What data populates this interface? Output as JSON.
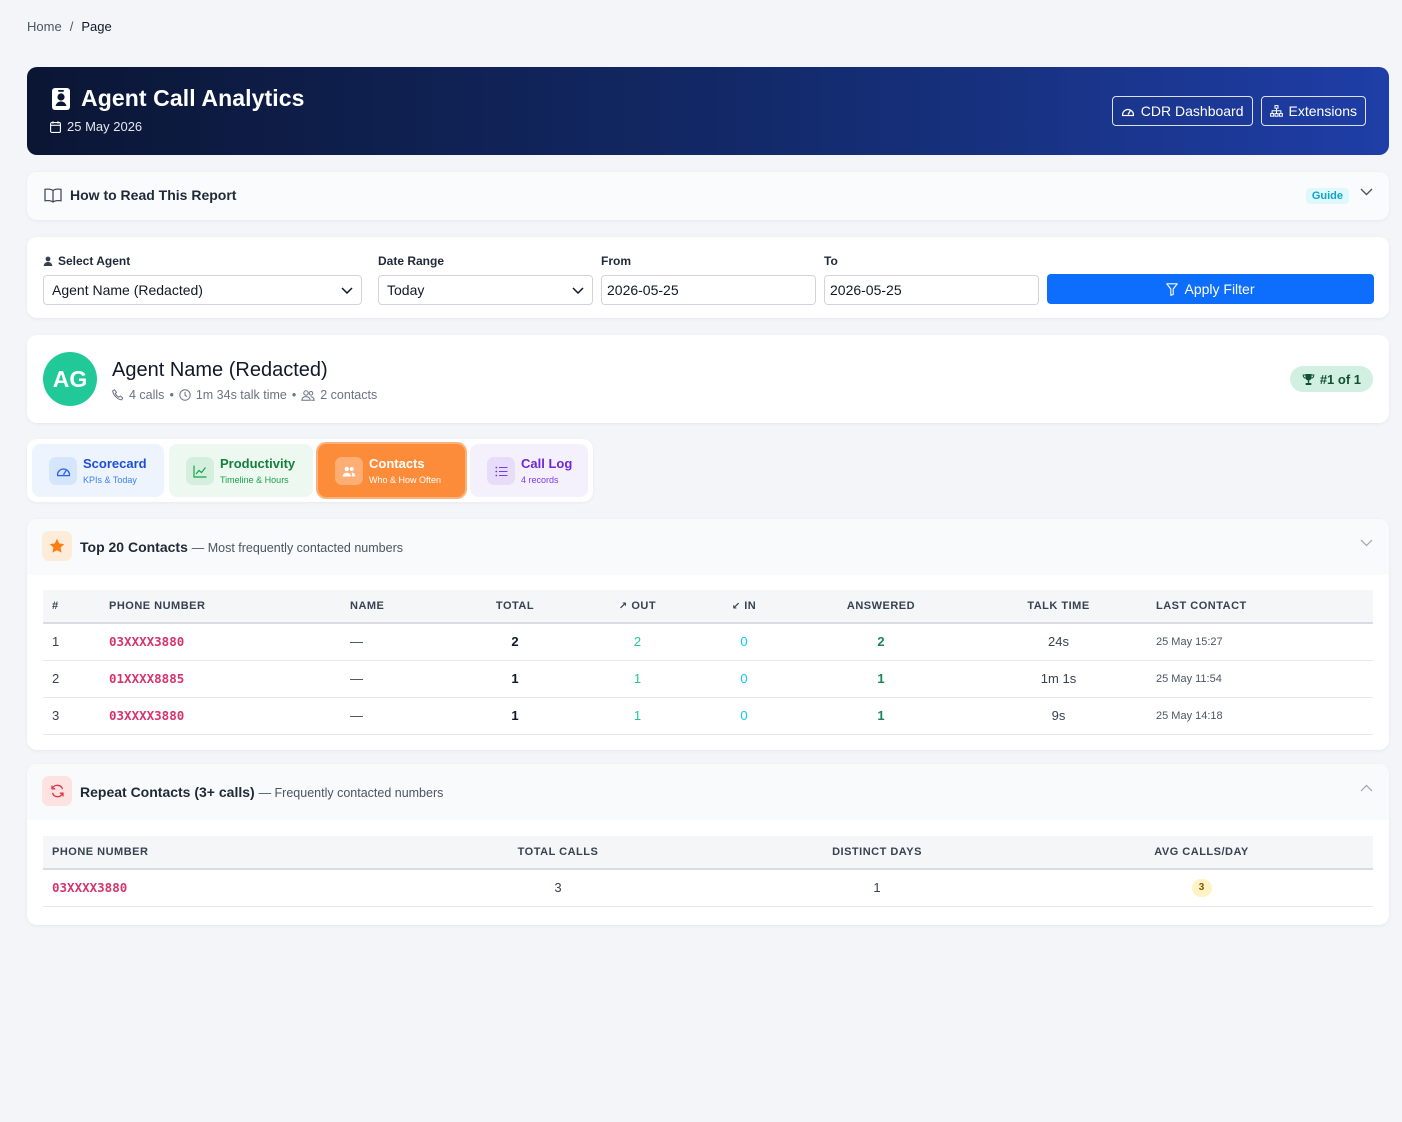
{
  "breadcrumb": {
    "home": "Home",
    "sep": "/",
    "current": "Page"
  },
  "header": {
    "title": "Agent Call Analytics",
    "date": "25 May 2026",
    "buttons": {
      "cdr": "CDR Dashboard",
      "extensions": "Extensions"
    },
    "gradient": [
      "#0b1634",
      "#1f3ea7"
    ]
  },
  "guide": {
    "title": "How to Read This Report",
    "badge": "Guide"
  },
  "filters": {
    "agent_label": "Select Agent",
    "agent_value": "Agent Name (Redacted)",
    "range_label": "Date Range",
    "range_value": "Today",
    "from_label": "From",
    "from_value": "2026-05-25",
    "to_label": "To",
    "to_value": "2026-05-25",
    "apply_label": "Apply Filter"
  },
  "agent": {
    "initials": "AG",
    "name": "Agent Name (Redacted)",
    "calls": "4 calls",
    "talk_time": "1m 34s talk time",
    "contacts": "2 contacts",
    "dot": "•",
    "rank": "#1 of 1",
    "avatar_color": "#20c997"
  },
  "tabs": [
    {
      "name": "Scorecard",
      "sub": "KPIs & Today",
      "icon": "gauge-icon"
    },
    {
      "name": "Productivity",
      "sub": "Timeline & Hours",
      "icon": "line-chart-icon"
    },
    {
      "name": "Contacts",
      "sub": "Who & How Often",
      "icon": "people-icon",
      "active": true
    },
    {
      "name": "Call Log",
      "sub": "4 records",
      "icon": "list-icon"
    }
  ],
  "top_contacts": {
    "title": "Top 20 Contacts",
    "subtitle": "— Most frequently contacted numbers",
    "columns": {
      "idx": "#",
      "phone": "PHONE NUMBER",
      "name": "NAME",
      "total": "TOTAL",
      "out": "OUT",
      "in": "IN",
      "answered": "ANSWERED",
      "talk": "TALK TIME",
      "last": "LAST CONTACT"
    },
    "rows": [
      {
        "idx": "1",
        "phone": "03XXXX3880",
        "name": "—",
        "total": "2",
        "out": "2",
        "in": "0",
        "answered": "2",
        "talk": "24s",
        "last": "25 May 15:27"
      },
      {
        "idx": "2",
        "phone": "01XXXX8885",
        "name": "—",
        "total": "1",
        "out": "1",
        "in": "0",
        "answered": "1",
        "talk": "1m 1s",
        "last": "25 May 11:54"
      },
      {
        "idx": "3",
        "phone": "03XXXX3880",
        "name": "—",
        "total": "1",
        "out": "1",
        "in": "0",
        "answered": "1",
        "talk": "9s",
        "last": "25 May 14:18"
      }
    ]
  },
  "repeat_contacts": {
    "title": "Repeat Contacts (3+ calls)",
    "subtitle": "— Frequently contacted numbers",
    "columns": {
      "phone": "PHONE NUMBER",
      "total": "TOTAL CALLS",
      "days": "DISTINCT DAYS",
      "avg": "AVG CALLS/DAY"
    },
    "rows": [
      {
        "phone": "03XXXX3880",
        "total": "3",
        "days": "1",
        "avg": "3"
      }
    ]
  }
}
